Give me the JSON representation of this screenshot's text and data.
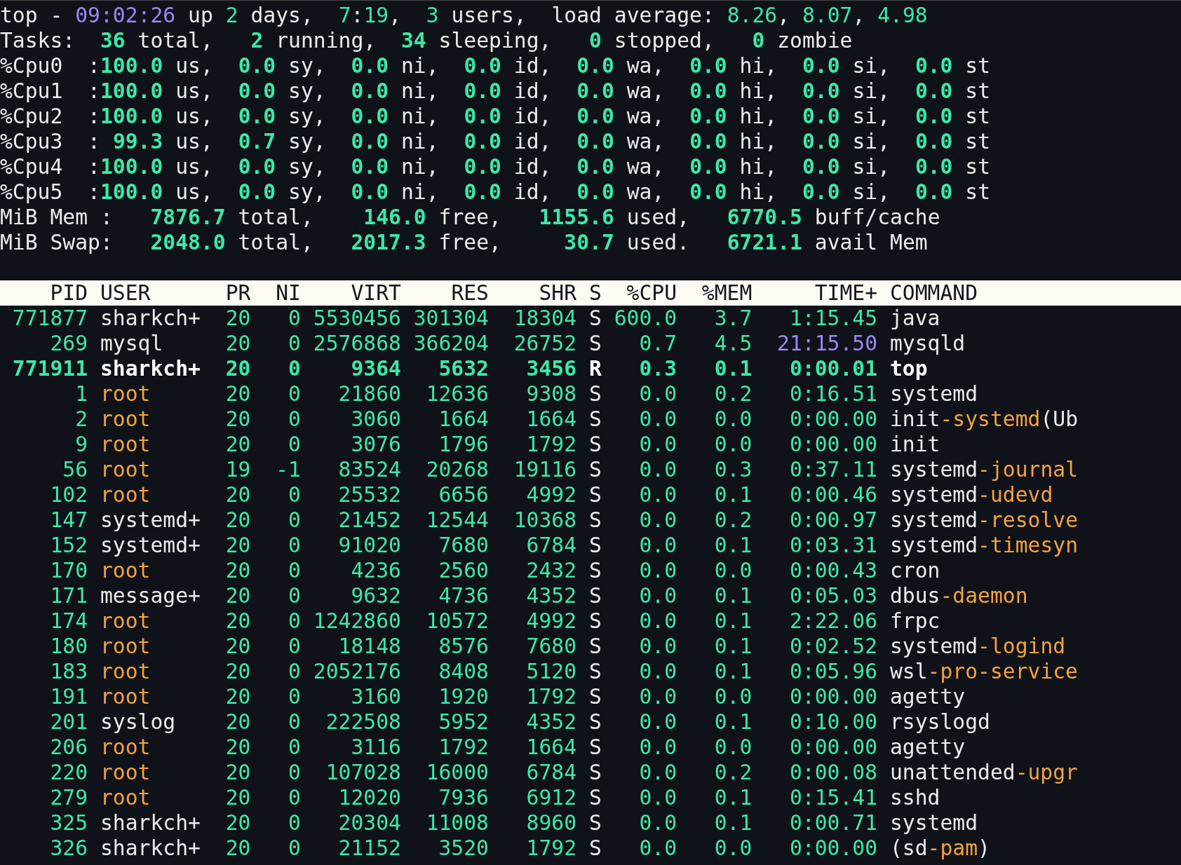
{
  "summary": [
    [
      {
        "text": "top - ",
        "kind": "plain"
      },
      {
        "text": "09:02:26",
        "kind": "time"
      },
      {
        "text": " up ",
        "kind": "plain"
      },
      {
        "text": "2",
        "kind": "num"
      },
      {
        "text": " days,  ",
        "kind": "plain"
      },
      {
        "text": "7",
        "kind": "num"
      },
      {
        "text": ":",
        "kind": "plain"
      },
      {
        "text": "19",
        "kind": "num"
      },
      {
        "text": ",  ",
        "kind": "plain"
      },
      {
        "text": "3",
        "kind": "num"
      },
      {
        "text": " users,  load average: ",
        "kind": "plain"
      },
      {
        "text": "8.26",
        "kind": "num"
      },
      {
        "text": ", ",
        "kind": "plain"
      },
      {
        "text": "8.07",
        "kind": "num"
      },
      {
        "text": ", ",
        "kind": "plain"
      },
      {
        "text": "4.98",
        "kind": "num"
      }
    ],
    [
      {
        "text": "Tasks:  ",
        "kind": "plain"
      },
      {
        "text": "36",
        "kind": "bold"
      },
      {
        "text": " total,   ",
        "kind": "plain"
      },
      {
        "text": "2",
        "kind": "bold"
      },
      {
        "text": " running,  ",
        "kind": "plain"
      },
      {
        "text": "34",
        "kind": "bold"
      },
      {
        "text": " sleeping,   ",
        "kind": "plain"
      },
      {
        "text": "0",
        "kind": "bold"
      },
      {
        "text": " stopped,   ",
        "kind": "plain"
      },
      {
        "text": "0",
        "kind": "bold"
      },
      {
        "text": " zombie",
        "kind": "plain"
      }
    ],
    [
      {
        "text": "%Cpu0  :",
        "kind": "plain"
      },
      {
        "text": "100.0",
        "kind": "bold"
      },
      {
        "text": " us,  ",
        "kind": "plain"
      },
      {
        "text": "0.0",
        "kind": "bold"
      },
      {
        "text": " sy,  ",
        "kind": "plain"
      },
      {
        "text": "0.0",
        "kind": "bold"
      },
      {
        "text": " ni,  ",
        "kind": "plain"
      },
      {
        "text": "0.0",
        "kind": "bold"
      },
      {
        "text": " id,  ",
        "kind": "plain"
      },
      {
        "text": "0.0",
        "kind": "bold"
      },
      {
        "text": " wa,  ",
        "kind": "plain"
      },
      {
        "text": "0.0",
        "kind": "bold"
      },
      {
        "text": " hi,  ",
        "kind": "plain"
      },
      {
        "text": "0.0",
        "kind": "bold"
      },
      {
        "text": " si,  ",
        "kind": "plain"
      },
      {
        "text": "0.0",
        "kind": "bold"
      },
      {
        "text": " st",
        "kind": "plain"
      }
    ],
    [
      {
        "text": "%Cpu1  :",
        "kind": "plain"
      },
      {
        "text": "100.0",
        "kind": "bold"
      },
      {
        "text": " us,  ",
        "kind": "plain"
      },
      {
        "text": "0.0",
        "kind": "bold"
      },
      {
        "text": " sy,  ",
        "kind": "plain"
      },
      {
        "text": "0.0",
        "kind": "bold"
      },
      {
        "text": " ni,  ",
        "kind": "plain"
      },
      {
        "text": "0.0",
        "kind": "bold"
      },
      {
        "text": " id,  ",
        "kind": "plain"
      },
      {
        "text": "0.0",
        "kind": "bold"
      },
      {
        "text": " wa,  ",
        "kind": "plain"
      },
      {
        "text": "0.0",
        "kind": "bold"
      },
      {
        "text": " hi,  ",
        "kind": "plain"
      },
      {
        "text": "0.0",
        "kind": "bold"
      },
      {
        "text": " si,  ",
        "kind": "plain"
      },
      {
        "text": "0.0",
        "kind": "bold"
      },
      {
        "text": " st",
        "kind": "plain"
      }
    ],
    [
      {
        "text": "%Cpu2  :",
        "kind": "plain"
      },
      {
        "text": "100.0",
        "kind": "bold"
      },
      {
        "text": " us,  ",
        "kind": "plain"
      },
      {
        "text": "0.0",
        "kind": "bold"
      },
      {
        "text": " sy,  ",
        "kind": "plain"
      },
      {
        "text": "0.0",
        "kind": "bold"
      },
      {
        "text": " ni,  ",
        "kind": "plain"
      },
      {
        "text": "0.0",
        "kind": "bold"
      },
      {
        "text": " id,  ",
        "kind": "plain"
      },
      {
        "text": "0.0",
        "kind": "bold"
      },
      {
        "text": " wa,  ",
        "kind": "plain"
      },
      {
        "text": "0.0",
        "kind": "bold"
      },
      {
        "text": " hi,  ",
        "kind": "plain"
      },
      {
        "text": "0.0",
        "kind": "bold"
      },
      {
        "text": " si,  ",
        "kind": "plain"
      },
      {
        "text": "0.0",
        "kind": "bold"
      },
      {
        "text": " st",
        "kind": "plain"
      }
    ],
    [
      {
        "text": "%Cpu3  : ",
        "kind": "plain"
      },
      {
        "text": "99.3",
        "kind": "bold"
      },
      {
        "text": " us,  ",
        "kind": "plain"
      },
      {
        "text": "0.7",
        "kind": "bold"
      },
      {
        "text": " sy,  ",
        "kind": "plain"
      },
      {
        "text": "0.0",
        "kind": "bold"
      },
      {
        "text": " ni,  ",
        "kind": "plain"
      },
      {
        "text": "0.0",
        "kind": "bold"
      },
      {
        "text": " id,  ",
        "kind": "plain"
      },
      {
        "text": "0.0",
        "kind": "bold"
      },
      {
        "text": " wa,  ",
        "kind": "plain"
      },
      {
        "text": "0.0",
        "kind": "bold"
      },
      {
        "text": " hi,  ",
        "kind": "plain"
      },
      {
        "text": "0.0",
        "kind": "bold"
      },
      {
        "text": " si,  ",
        "kind": "plain"
      },
      {
        "text": "0.0",
        "kind": "bold"
      },
      {
        "text": " st",
        "kind": "plain"
      }
    ],
    [
      {
        "text": "%Cpu4  :",
        "kind": "plain"
      },
      {
        "text": "100.0",
        "kind": "bold"
      },
      {
        "text": " us,  ",
        "kind": "plain"
      },
      {
        "text": "0.0",
        "kind": "bold"
      },
      {
        "text": " sy,  ",
        "kind": "plain"
      },
      {
        "text": "0.0",
        "kind": "bold"
      },
      {
        "text": " ni,  ",
        "kind": "plain"
      },
      {
        "text": "0.0",
        "kind": "bold"
      },
      {
        "text": " id,  ",
        "kind": "plain"
      },
      {
        "text": "0.0",
        "kind": "bold"
      },
      {
        "text": " wa,  ",
        "kind": "plain"
      },
      {
        "text": "0.0",
        "kind": "bold"
      },
      {
        "text": " hi,  ",
        "kind": "plain"
      },
      {
        "text": "0.0",
        "kind": "bold"
      },
      {
        "text": " si,  ",
        "kind": "plain"
      },
      {
        "text": "0.0",
        "kind": "bold"
      },
      {
        "text": " st",
        "kind": "plain"
      }
    ],
    [
      {
        "text": "%Cpu5  :",
        "kind": "plain"
      },
      {
        "text": "100.0",
        "kind": "bold"
      },
      {
        "text": " us,  ",
        "kind": "plain"
      },
      {
        "text": "0.0",
        "kind": "bold"
      },
      {
        "text": " sy,  ",
        "kind": "plain"
      },
      {
        "text": "0.0",
        "kind": "bold"
      },
      {
        "text": " ni,  ",
        "kind": "plain"
      },
      {
        "text": "0.0",
        "kind": "bold"
      },
      {
        "text": " id,  ",
        "kind": "plain"
      },
      {
        "text": "0.0",
        "kind": "bold"
      },
      {
        "text": " wa,  ",
        "kind": "plain"
      },
      {
        "text": "0.0",
        "kind": "bold"
      },
      {
        "text": " hi,  ",
        "kind": "plain"
      },
      {
        "text": "0.0",
        "kind": "bold"
      },
      {
        "text": " si,  ",
        "kind": "plain"
      },
      {
        "text": "0.0",
        "kind": "bold"
      },
      {
        "text": " st",
        "kind": "plain"
      }
    ],
    [
      {
        "text": "MiB Mem :   ",
        "kind": "plain"
      },
      {
        "text": "7876.7",
        "kind": "bold"
      },
      {
        "text": " total,    ",
        "kind": "plain"
      },
      {
        "text": "146.0",
        "kind": "bold"
      },
      {
        "text": " free,   ",
        "kind": "plain"
      },
      {
        "text": "1155.6",
        "kind": "bold"
      },
      {
        "text": " used,   ",
        "kind": "plain"
      },
      {
        "text": "6770.5",
        "kind": "bold"
      },
      {
        "text": " buff/cache",
        "kind": "plain"
      }
    ],
    [
      {
        "text": "MiB Swap:   ",
        "kind": "plain"
      },
      {
        "text": "2048.0",
        "kind": "bold"
      },
      {
        "text": " total,   ",
        "kind": "plain"
      },
      {
        "text": "2017.3",
        "kind": "bold"
      },
      {
        "text": " free,     ",
        "kind": "plain"
      },
      {
        "text": "30.7",
        "kind": "bold"
      },
      {
        "text": " used.   ",
        "kind": "plain"
      },
      {
        "text": "6721.1",
        "kind": "bold"
      },
      {
        "text": " avail Mem",
        "kind": "plain"
      }
    ]
  ],
  "table": {
    "columns": [
      "PID",
      "USER",
      "PR",
      "NI",
      "VIRT",
      "RES",
      "SHR",
      "S",
      "%CPU",
      "%MEM",
      "TIME+",
      "COMMAND"
    ],
    "rows": [
      {
        "pid": "771877",
        "user": {
          "text": "sharkch+",
          "kind": "normal"
        },
        "pr": "20",
        "ni": "0",
        "virt": "5530456",
        "res": "301304",
        "shr": "18304",
        "s": "S",
        "cpu": "600.0",
        "mem": "3.7",
        "time": {
          "text": "1:15.45",
          "kind": "normal"
        },
        "bold": false,
        "command": [
          {
            "text": "java",
            "kind": "plain"
          }
        ]
      },
      {
        "pid": "269",
        "user": {
          "text": "mysql",
          "kind": "normal"
        },
        "pr": "20",
        "ni": "0",
        "virt": "2576868",
        "res": "366204",
        "shr": "26752",
        "s": "S",
        "cpu": "0.7",
        "mem": "4.5",
        "time": {
          "text": "21:15.50",
          "kind": "long"
        },
        "bold": false,
        "command": [
          {
            "text": "mysqld",
            "kind": "plain"
          }
        ]
      },
      {
        "pid": "771911",
        "user": {
          "text": "sharkch+",
          "kind": "normal"
        },
        "pr": "20",
        "ni": "0",
        "virt": "9364",
        "res": "5632",
        "shr": "3456",
        "s": "R",
        "cpu": "0.3",
        "mem": "0.1",
        "time": {
          "text": "0:00.01",
          "kind": "normal"
        },
        "bold": true,
        "command": [
          {
            "text": "top",
            "kind": "plain"
          }
        ]
      },
      {
        "pid": "1",
        "user": {
          "text": "root",
          "kind": "system"
        },
        "pr": "20",
        "ni": "0",
        "virt": "21860",
        "res": "12636",
        "shr": "9308",
        "s": "S",
        "cpu": "0.0",
        "mem": "0.2",
        "time": {
          "text": "0:16.51",
          "kind": "normal"
        },
        "bold": false,
        "command": [
          {
            "text": "systemd",
            "kind": "plain"
          }
        ]
      },
      {
        "pid": "2",
        "user": {
          "text": "root",
          "kind": "system"
        },
        "pr": "20",
        "ni": "0",
        "virt": "3060",
        "res": "1664",
        "shr": "1664",
        "s": "S",
        "cpu": "0.0",
        "mem": "0.0",
        "time": {
          "text": "0:00.00",
          "kind": "normal"
        },
        "bold": false,
        "command": [
          {
            "text": "init",
            "kind": "plain"
          },
          {
            "text": "-systemd",
            "kind": "accent"
          },
          {
            "text": "(Ub",
            "kind": "plain"
          }
        ]
      },
      {
        "pid": "9",
        "user": {
          "text": "root",
          "kind": "system"
        },
        "pr": "20",
        "ni": "0",
        "virt": "3076",
        "res": "1796",
        "shr": "1792",
        "s": "S",
        "cpu": "0.0",
        "mem": "0.0",
        "time": {
          "text": "0:00.00",
          "kind": "normal"
        },
        "bold": false,
        "command": [
          {
            "text": "init",
            "kind": "plain"
          }
        ]
      },
      {
        "pid": "56",
        "user": {
          "text": "root",
          "kind": "system"
        },
        "pr": "19",
        "ni": "-1",
        "virt": "83524",
        "res": "20268",
        "shr": "19116",
        "s": "S",
        "cpu": "0.0",
        "mem": "0.3",
        "time": {
          "text": "0:37.11",
          "kind": "normal"
        },
        "bold": false,
        "command": [
          {
            "text": "systemd",
            "kind": "plain"
          },
          {
            "text": "-journal",
            "kind": "accent"
          }
        ]
      },
      {
        "pid": "102",
        "user": {
          "text": "root",
          "kind": "system"
        },
        "pr": "20",
        "ni": "0",
        "virt": "25532",
        "res": "6656",
        "shr": "4992",
        "s": "S",
        "cpu": "0.0",
        "mem": "0.1",
        "time": {
          "text": "0:00.46",
          "kind": "normal"
        },
        "bold": false,
        "command": [
          {
            "text": "systemd",
            "kind": "plain"
          },
          {
            "text": "-udevd",
            "kind": "accent"
          }
        ]
      },
      {
        "pid": "147",
        "user": {
          "text": "systemd+",
          "kind": "normal"
        },
        "pr": "20",
        "ni": "0",
        "virt": "21452",
        "res": "12544",
        "shr": "10368",
        "s": "S",
        "cpu": "0.0",
        "mem": "0.2",
        "time": {
          "text": "0:00.97",
          "kind": "normal"
        },
        "bold": false,
        "command": [
          {
            "text": "systemd",
            "kind": "plain"
          },
          {
            "text": "-resolve",
            "kind": "accent"
          }
        ]
      },
      {
        "pid": "152",
        "user": {
          "text": "systemd+",
          "kind": "normal"
        },
        "pr": "20",
        "ni": "0",
        "virt": "91020",
        "res": "7680",
        "shr": "6784",
        "s": "S",
        "cpu": "0.0",
        "mem": "0.1",
        "time": {
          "text": "0:03.31",
          "kind": "normal"
        },
        "bold": false,
        "command": [
          {
            "text": "systemd",
            "kind": "plain"
          },
          {
            "text": "-timesyn",
            "kind": "accent"
          }
        ]
      },
      {
        "pid": "170",
        "user": {
          "text": "root",
          "kind": "system"
        },
        "pr": "20",
        "ni": "0",
        "virt": "4236",
        "res": "2560",
        "shr": "2432",
        "s": "S",
        "cpu": "0.0",
        "mem": "0.0",
        "time": {
          "text": "0:00.43",
          "kind": "normal"
        },
        "bold": false,
        "command": [
          {
            "text": "cron",
            "kind": "plain"
          }
        ]
      },
      {
        "pid": "171",
        "user": {
          "text": "message+",
          "kind": "normal"
        },
        "pr": "20",
        "ni": "0",
        "virt": "9632",
        "res": "4736",
        "shr": "4352",
        "s": "S",
        "cpu": "0.0",
        "mem": "0.1",
        "time": {
          "text": "0:05.03",
          "kind": "normal"
        },
        "bold": false,
        "command": [
          {
            "text": "dbus",
            "kind": "plain"
          },
          {
            "text": "-daemon",
            "kind": "accent"
          }
        ]
      },
      {
        "pid": "174",
        "user": {
          "text": "root",
          "kind": "system"
        },
        "pr": "20",
        "ni": "0",
        "virt": "1242860",
        "res": "10572",
        "shr": "4992",
        "s": "S",
        "cpu": "0.0",
        "mem": "0.1",
        "time": {
          "text": "2:22.06",
          "kind": "normal"
        },
        "bold": false,
        "command": [
          {
            "text": "frpc",
            "kind": "plain"
          }
        ]
      },
      {
        "pid": "180",
        "user": {
          "text": "root",
          "kind": "system"
        },
        "pr": "20",
        "ni": "0",
        "virt": "18148",
        "res": "8576",
        "shr": "7680",
        "s": "S",
        "cpu": "0.0",
        "mem": "0.1",
        "time": {
          "text": "0:02.52",
          "kind": "normal"
        },
        "bold": false,
        "command": [
          {
            "text": "systemd",
            "kind": "plain"
          },
          {
            "text": "-logind",
            "kind": "accent"
          }
        ]
      },
      {
        "pid": "183",
        "user": {
          "text": "root",
          "kind": "system"
        },
        "pr": "20",
        "ni": "0",
        "virt": "2052176",
        "res": "8408",
        "shr": "5120",
        "s": "S",
        "cpu": "0.0",
        "mem": "0.1",
        "time": {
          "text": "0:05.96",
          "kind": "normal"
        },
        "bold": false,
        "command": [
          {
            "text": "wsl",
            "kind": "plain"
          },
          {
            "text": "-pro-service",
            "kind": "accent"
          }
        ]
      },
      {
        "pid": "191",
        "user": {
          "text": "root",
          "kind": "system"
        },
        "pr": "20",
        "ni": "0",
        "virt": "3160",
        "res": "1920",
        "shr": "1792",
        "s": "S",
        "cpu": "0.0",
        "mem": "0.0",
        "time": {
          "text": "0:00.00",
          "kind": "normal"
        },
        "bold": false,
        "command": [
          {
            "text": "agetty",
            "kind": "plain"
          }
        ]
      },
      {
        "pid": "201",
        "user": {
          "text": "syslog",
          "kind": "normal"
        },
        "pr": "20",
        "ni": "0",
        "virt": "222508",
        "res": "5952",
        "shr": "4352",
        "s": "S",
        "cpu": "0.0",
        "mem": "0.1",
        "time": {
          "text": "0:10.00",
          "kind": "normal"
        },
        "bold": false,
        "command": [
          {
            "text": "rsyslogd",
            "kind": "plain"
          }
        ]
      },
      {
        "pid": "206",
        "user": {
          "text": "root",
          "kind": "system"
        },
        "pr": "20",
        "ni": "0",
        "virt": "3116",
        "res": "1792",
        "shr": "1664",
        "s": "S",
        "cpu": "0.0",
        "mem": "0.0",
        "time": {
          "text": "0:00.00",
          "kind": "normal"
        },
        "bold": false,
        "command": [
          {
            "text": "agetty",
            "kind": "plain"
          }
        ]
      },
      {
        "pid": "220",
        "user": {
          "text": "root",
          "kind": "system"
        },
        "pr": "20",
        "ni": "0",
        "virt": "107028",
        "res": "16000",
        "shr": "6784",
        "s": "S",
        "cpu": "0.0",
        "mem": "0.2",
        "time": {
          "text": "0:00.08",
          "kind": "normal"
        },
        "bold": false,
        "command": [
          {
            "text": "unattended",
            "kind": "plain"
          },
          {
            "text": "-upgr",
            "kind": "accent"
          }
        ]
      },
      {
        "pid": "279",
        "user": {
          "text": "root",
          "kind": "system"
        },
        "pr": "20",
        "ni": "0",
        "virt": "12020",
        "res": "7936",
        "shr": "6912",
        "s": "S",
        "cpu": "0.0",
        "mem": "0.1",
        "time": {
          "text": "0:15.41",
          "kind": "normal"
        },
        "bold": false,
        "command": [
          {
            "text": "sshd",
            "kind": "plain"
          }
        ]
      },
      {
        "pid": "325",
        "user": {
          "text": "sharkch+",
          "kind": "normal"
        },
        "pr": "20",
        "ni": "0",
        "virt": "20304",
        "res": "11008",
        "shr": "8960",
        "s": "S",
        "cpu": "0.0",
        "mem": "0.1",
        "time": {
          "text": "0:00.71",
          "kind": "normal"
        },
        "bold": false,
        "command": [
          {
            "text": "systemd",
            "kind": "plain"
          }
        ]
      },
      {
        "pid": "326",
        "user": {
          "text": "sharkch+",
          "kind": "normal"
        },
        "pr": "20",
        "ni": "0",
        "virt": "21152",
        "res": "3520",
        "shr": "1792",
        "s": "S",
        "cpu": "0.0",
        "mem": "0.0",
        "time": {
          "text": "0:00.00",
          "kind": "normal"
        },
        "bold": false,
        "command": [
          {
            "text": "(sd",
            "kind": "plain"
          },
          {
            "text": "-pam",
            "kind": "accent"
          },
          {
            "text": ")",
            "kind": "plain"
          }
        ]
      }
    ]
  }
}
